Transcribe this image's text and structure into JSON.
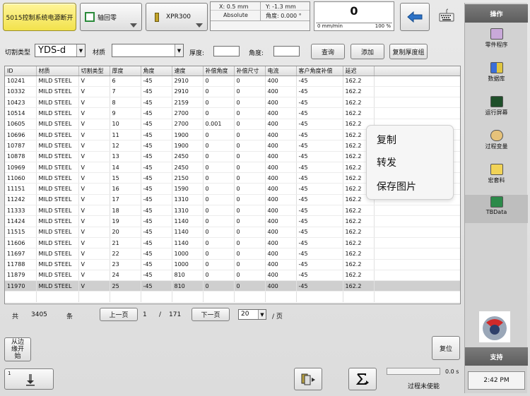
{
  "topbar": {
    "status_label": "5015控制系统电源断开",
    "axis_button_label": "轴回零",
    "tool_button_label": "XPR300",
    "coords": {
      "x": "X: 0.5 mm",
      "y": "Y: -1.3 mm",
      "mode": "Absolute",
      "angle": "角度: 0.000 °"
    },
    "speed_value": "0",
    "speed_unit": "0 mm/min",
    "speed_pct": "100 %"
  },
  "filter": {
    "cut_type_label": "切割类型",
    "cut_type_value": "YDS-d",
    "material_label": "材质",
    "material_value": "",
    "thickness_label": "厚度:",
    "angle_label": "角度:",
    "query_button": "查询",
    "add_button": "添加",
    "copy_thickness_button": "复制厚度组"
  },
  "table": {
    "columns": [
      "ID",
      "材质",
      "切割类型",
      "厚度",
      "角度",
      "速度",
      "补偿角度",
      "补偿尺寸",
      "电流",
      "客户角度补偿",
      "延迟"
    ],
    "rows": [
      [
        "10241",
        "MILD STEEL",
        "V",
        "6",
        "-45",
        "2910",
        "0",
        "0",
        "400",
        "-45",
        "162.2"
      ],
      [
        "10332",
        "MILD STEEL",
        "V",
        "7",
        "-45",
        "2910",
        "0",
        "0",
        "400",
        "-45",
        "162.2"
      ],
      [
        "10423",
        "MILD STEEL",
        "V",
        "8",
        "-45",
        "2159",
        "0",
        "0",
        "400",
        "-45",
        "162.2"
      ],
      [
        "10514",
        "MILD STEEL",
        "V",
        "9",
        "-45",
        "2700",
        "0",
        "0",
        "400",
        "-45",
        "162.2"
      ],
      [
        "10605",
        "MILD STEEL",
        "V",
        "10",
        "-45",
        "2700",
        "0.001",
        "0",
        "400",
        "-45",
        "162.2"
      ],
      [
        "10696",
        "MILD STEEL",
        "V",
        "11",
        "-45",
        "1900",
        "0",
        "0",
        "400",
        "-45",
        "162.2"
      ],
      [
        "10787",
        "MILD STEEL",
        "V",
        "12",
        "-45",
        "1900",
        "0",
        "0",
        "400",
        "-45",
        "162.2"
      ],
      [
        "10878",
        "MILD STEEL",
        "V",
        "13",
        "-45",
        "2450",
        "0",
        "0",
        "400",
        "-45",
        "162.2"
      ],
      [
        "10969",
        "MILD STEEL",
        "V",
        "14",
        "-45",
        "2450",
        "0",
        "0",
        "400",
        "-45",
        "162.2"
      ],
      [
        "11060",
        "MILD STEEL",
        "V",
        "15",
        "-45",
        "2150",
        "0",
        "0",
        "400",
        "-45",
        "162.2"
      ],
      [
        "11151",
        "MILD STEEL",
        "V",
        "16",
        "-45",
        "1590",
        "0",
        "0",
        "400",
        "-45",
        "162.2"
      ],
      [
        "11242",
        "MILD STEEL",
        "V",
        "17",
        "-45",
        "1310",
        "0",
        "0",
        "400",
        "-45",
        "162.2"
      ],
      [
        "11333",
        "MILD STEEL",
        "V",
        "18",
        "-45",
        "1310",
        "0",
        "0",
        "400",
        "-45",
        "162.2"
      ],
      [
        "11424",
        "MILD STEEL",
        "V",
        "19",
        "-45",
        "1140",
        "0",
        "0",
        "400",
        "-45",
        "162.2"
      ],
      [
        "11515",
        "MILD STEEL",
        "V",
        "20",
        "-45",
        "1140",
        "0",
        "0",
        "400",
        "-45",
        "162.2"
      ],
      [
        "11606",
        "MILD STEEL",
        "V",
        "21",
        "-45",
        "1140",
        "0",
        "0",
        "400",
        "-45",
        "162.2"
      ],
      [
        "11697",
        "MILD STEEL",
        "V",
        "22",
        "-45",
        "1000",
        "0",
        "0",
        "400",
        "-45",
        "162.2"
      ],
      [
        "11788",
        "MILD STEEL",
        "V",
        "23",
        "-45",
        "1000",
        "0",
        "0",
        "400",
        "-45",
        "162.2"
      ],
      [
        "11879",
        "MILD STEEL",
        "V",
        "24",
        "-45",
        "810",
        "0",
        "0",
        "400",
        "-45",
        "162.2"
      ],
      [
        "11970",
        "MILD STEEL",
        "V",
        "25",
        "-45",
        "810",
        "0",
        "0",
        "400",
        "-45",
        "162.2"
      ]
    ]
  },
  "context_menu": {
    "copy": "复制",
    "forward": "转发",
    "save_image": "保存图片"
  },
  "pager": {
    "total_prefix": "共",
    "total_count": "3405",
    "total_suffix": "条",
    "prev_button": "上一页",
    "current_page": "1",
    "slash": "/",
    "page_count": "171",
    "next_button": "下一页",
    "page_size": "20",
    "page_suffix": "/ 页"
  },
  "bottom": {
    "edge_start_button": "从边缘开始",
    "reset_button": "复位",
    "small_index": "1",
    "timer": "0.0 s",
    "process_status": "过程未使能"
  },
  "sidebar": {
    "header": "操作",
    "items": [
      "零件程序",
      "数据库",
      "运行屏幕",
      "过程变量",
      "宏套料",
      "TBData"
    ],
    "support": "支持",
    "time": "2:42 PM"
  },
  "colors": {
    "status_yellow": "#f5e85a",
    "selected_row": "#cfcfcf",
    "sidebar_bg": "#d2d2d2",
    "back_arrow_blue": "#2c72c7"
  }
}
